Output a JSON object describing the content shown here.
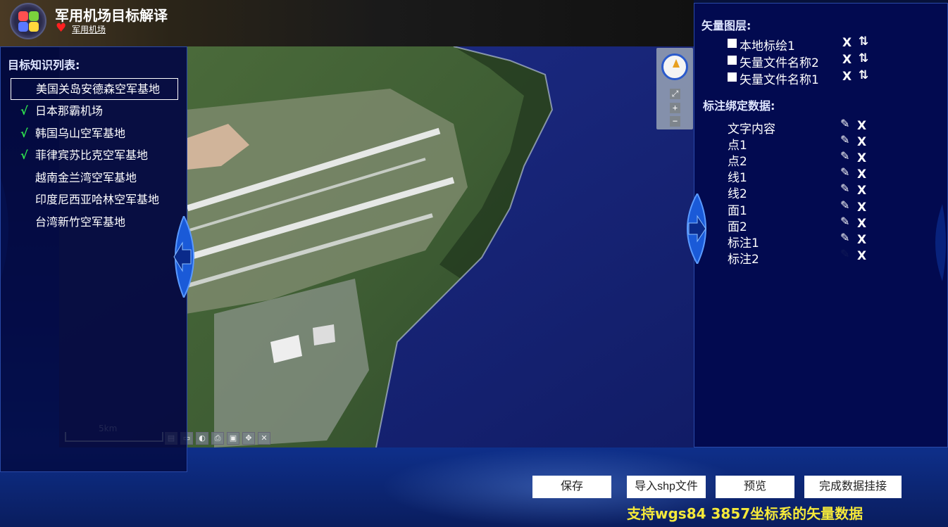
{
  "header": {
    "title": "军用机场目标解译",
    "subtitle_link": "军用机场"
  },
  "left_panel": {
    "title": "目标知识列表:",
    "items": [
      {
        "label": "美国关岛安德森空军基地",
        "checked": false,
        "selected": true
      },
      {
        "label": "日本那霸机场",
        "checked": true,
        "selected": false
      },
      {
        "label": "韩国乌山空军基地",
        "checked": true,
        "selected": false
      },
      {
        "label": "菲律宾苏比克空军基地",
        "checked": true,
        "selected": false
      },
      {
        "label": "越南金兰湾空军基地",
        "checked": false,
        "selected": false
      },
      {
        "label": "印度尼西亚哈林空军基地",
        "checked": false,
        "selected": false
      },
      {
        "label": "台湾新竹空军基地",
        "checked": false,
        "selected": false
      }
    ],
    "check_glyph": "√"
  },
  "map": {
    "scale_label": "5km",
    "zoom_in": "+",
    "zoom_out": "−",
    "fullscreen": "⤢"
  },
  "right_panel": {
    "layers_title": "矢量图层:",
    "layers": [
      {
        "label": "本地标绘1"
      },
      {
        "label": "矢量文件名称2"
      },
      {
        "label": "矢量文件名称1"
      }
    ],
    "delete_glyph": "X",
    "order_glyph": "⇅",
    "bind_title": "标注绑定数据:",
    "bind_items": [
      {
        "label": "文字内容",
        "editable": true
      },
      {
        "label": "点1",
        "editable": true
      },
      {
        "label": "点2",
        "editable": true
      },
      {
        "label": "线1",
        "editable": true
      },
      {
        "label": "线2",
        "editable": true
      },
      {
        "label": "面1",
        "editable": true
      },
      {
        "label": "面2",
        "editable": true
      },
      {
        "label": "标注1",
        "editable": true
      },
      {
        "label": "标注2",
        "editable": false
      }
    ],
    "edit_glyph": "✎"
  },
  "bottom": {
    "save": "保存",
    "import_shp": "导入shp文件",
    "preview": "预览",
    "finish": "完成数据挂接",
    "notice": "支持wgs84 3857坐标系的矢量数据"
  },
  "colors": {
    "panel_bg": "#020a50",
    "accent_check": "#2ee04e",
    "notice_yellow": "#f5e93a",
    "border_blue": "#2a4aa8"
  }
}
